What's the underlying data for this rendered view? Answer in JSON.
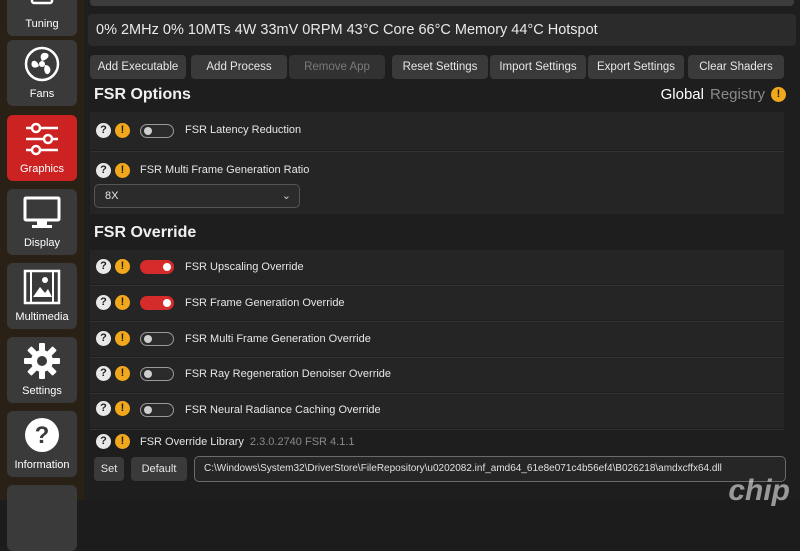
{
  "sidebar": {
    "items": [
      {
        "label": "Tuning",
        "icon": "tuning-icon"
      },
      {
        "label": "Fans",
        "icon": "fan-icon"
      },
      {
        "label": "Graphics",
        "icon": "sliders-icon",
        "active": true
      },
      {
        "label": "Display",
        "icon": "monitor-icon"
      },
      {
        "label": "Multimedia",
        "icon": "film-icon"
      },
      {
        "label": "Settings",
        "icon": "gear-icon"
      },
      {
        "label": "Information",
        "icon": "question-icon"
      }
    ]
  },
  "stats": {
    "text": "0%  2MHz  0%  10MTs  4W  33mV  0RPM  43°C Core  66°C Memory  44°C Hotspot"
  },
  "toolbar": {
    "buttons": [
      {
        "label": "Add Executable"
      },
      {
        "label": "Add Process"
      },
      {
        "label": "Remove App",
        "disabled": true
      },
      {
        "label": "Reset Settings"
      },
      {
        "label": "Import Settings"
      },
      {
        "label": "Export Settings"
      },
      {
        "label": "Clear Shaders"
      }
    ]
  },
  "fsr_options": {
    "title": "FSR Options",
    "mode_global": "Global",
    "mode_registry": "Registry",
    "latency_label": "FSR Latency Reduction",
    "latency_on": false,
    "ratio_label": "FSR Multi Frame Generation Ratio",
    "ratio_value": "8X"
  },
  "fsr_override": {
    "title": "FSR Override",
    "rows": [
      {
        "label": "FSR Upscaling Override",
        "on": true
      },
      {
        "label": "FSR Frame Generation Override",
        "on": true
      },
      {
        "label": "FSR Multi Frame Generation Override",
        "on": false
      },
      {
        "label": "FSR Ray Regeneration Denoiser Override",
        "on": false
      },
      {
        "label": "FSR Neural Radiance Caching Override",
        "on": false
      }
    ],
    "library_label": "FSR Override Library",
    "library_version": "2.3.0.2740 FSR 4.1.1",
    "set_label": "Set",
    "default_label": "Default",
    "path": "C:\\Windows\\System32\\DriverStore\\FileRepository\\u0202082.inf_amd64_61e8e071c4b56ef4\\B026218\\amdxcffx64.dll"
  },
  "watermark": "chip",
  "colors": {
    "accent": "#cc2222",
    "warning": "#f2a81c"
  }
}
